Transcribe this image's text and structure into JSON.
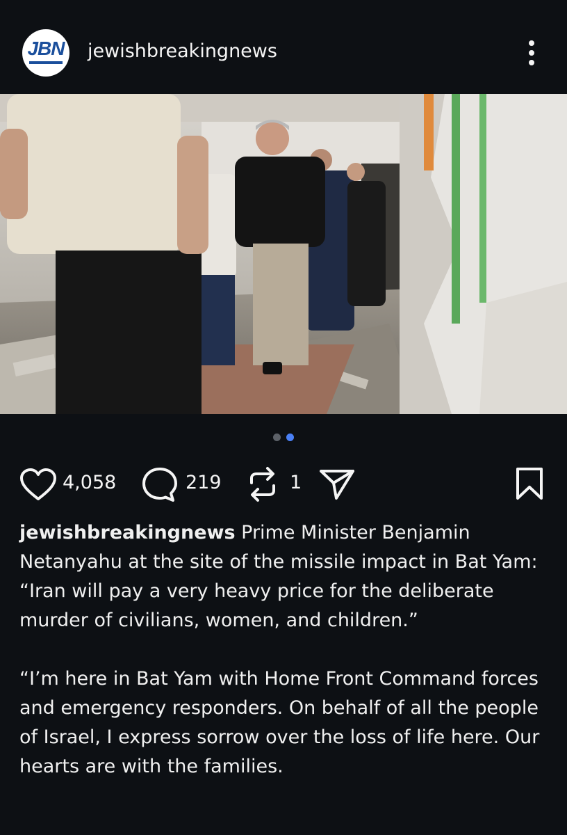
{
  "post": {
    "account": {
      "username": "jewishbreakingnews",
      "avatar_logo": "JBN"
    },
    "more_icon": "more-vertical-icon",
    "carousel": {
      "total": 2,
      "active_index": 1
    },
    "actions": {
      "like_count": "4,058",
      "comment_count": "219",
      "repost_count": "1",
      "icons": [
        "heart-icon",
        "comment-icon",
        "repost-icon",
        "share-icon",
        "bookmark-icon"
      ]
    },
    "caption": {
      "handle": "jewishbreakingnews",
      "text_1": "Prime Minister Benjamin Netanyahu at the site of the missile impact in Bat Yam: “Iran will pay a very heavy price for the deliberate murder of civilians, women, and children.”",
      "text_2": "“I’m here in Bat Yam with Home Front Command forces and emergency responders. On behalf of all the people of Israel, I express sorrow over the loss of life here. Our hearts are with the families."
    }
  },
  "colors": {
    "background": "#0d1014",
    "carousel_active": "#4a80f5",
    "carousel_inactive": "#5c6168",
    "brand": "#1b4f9c"
  }
}
